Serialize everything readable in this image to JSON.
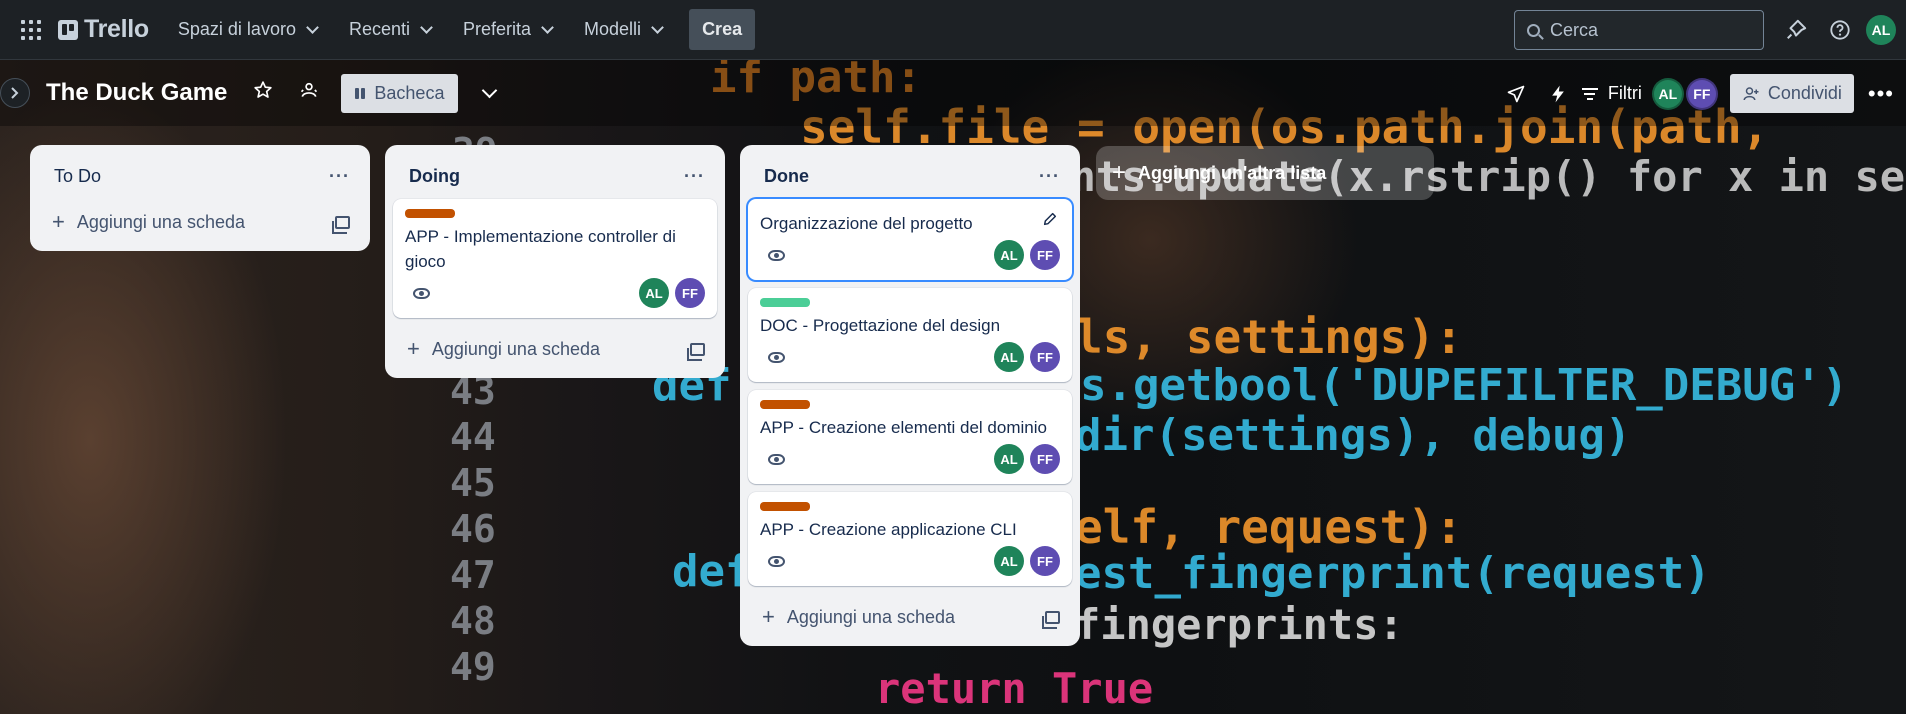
{
  "topnav": {
    "logo": "Trello",
    "menu": [
      {
        "label": "Spazi di lavoro"
      },
      {
        "label": "Recenti"
      },
      {
        "label": "Preferita"
      },
      {
        "label": "Modelli"
      }
    ],
    "create_label": "Crea",
    "search_placeholder": "Cerca",
    "user_initials": "AL"
  },
  "board": {
    "title": "The Duck Game",
    "view_label": "Bacheca",
    "filter_label": "Filtri",
    "share_label": "Condividi",
    "members": [
      "AL",
      "FF"
    ],
    "add_list_label": "Aggiungi un'altra lista",
    "add_card_label": "Aggiungi una scheda"
  },
  "lists": [
    {
      "title": "To Do",
      "cards": []
    },
    {
      "title": "Doing",
      "cards": [
        {
          "label_color": "#c25100",
          "title": "APP - Implementazione controller di gioco",
          "members": [
            "AL",
            "FF"
          ]
        }
      ]
    },
    {
      "title": "Done",
      "cards": [
        {
          "label_color": "",
          "title": "Organizzazione del progetto",
          "members": [
            "AL",
            "FF"
          ]
        },
        {
          "label_color": "#4bce97",
          "title": "DOC - Progettazione del design",
          "members": [
            "AL",
            "FF"
          ]
        },
        {
          "label_color": "#c25100",
          "title": "APP - Creazione elementi del dominio",
          "members": [
            "AL",
            "FF"
          ]
        },
        {
          "label_color": "#c25100",
          "title": "APP - Creazione applicazione CLI",
          "members": [
            "AL",
            "FF"
          ]
        }
      ]
    }
  ],
  "colors": {
    "member_al": "#1f845a",
    "member_ff": "#5e4db2",
    "selected_outline": "#388bff"
  },
  "background_code": {
    "line_numbers": [
      "39",
      "43",
      "44",
      "45",
      "46",
      "47",
      "48",
      "49"
    ],
    "lines": [
      "if path:",
      "self.file = open(os.path.join(path,",
      "rints.update(x.rstrip() for x in self.file",
      "ls, settings):",
      "s.getbool('DUPEFILTER_DEBUG')",
      "dir(settings), debug)",
      "elf, request):",
      "est_fingerprint(request)",
      "fingerprints:",
      "return True",
      "def",
      "def"
    ]
  }
}
